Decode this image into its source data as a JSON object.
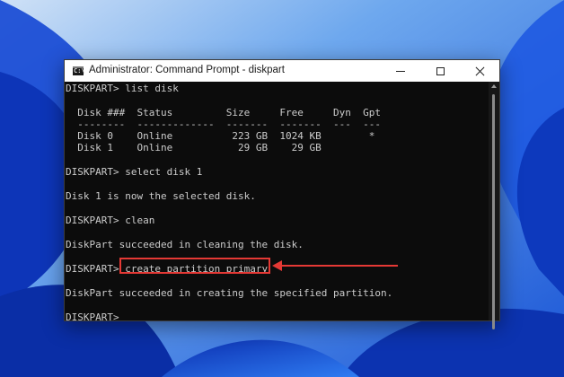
{
  "window": {
    "title": "Administrator: Command Prompt - diskpart",
    "icon": "cmd-icon",
    "icon_glyph": "C:\\"
  },
  "console": {
    "lines": [
      "DISKPART> list disk",
      "",
      "  Disk ###  Status         Size     Free     Dyn  Gpt",
      "  --------  -------------  -------  -------  ---  ---",
      "  Disk 0    Online          223 GB  1024 KB        *",
      "  Disk 1    Online           29 GB    29 GB",
      "",
      "DISKPART> select disk 1",
      "",
      "Disk 1 is now the selected disk.",
      "",
      "DISKPART> clean",
      "",
      "DiskPart succeeded in cleaning the disk.",
      "",
      "DISKPART> create partition primary",
      "",
      "DiskPart succeeded in creating the specified partition.",
      "",
      "DISKPART>"
    ]
  },
  "annotation": {
    "highlighted_text": "create partition primary",
    "highlight_color": "#e53935"
  }
}
